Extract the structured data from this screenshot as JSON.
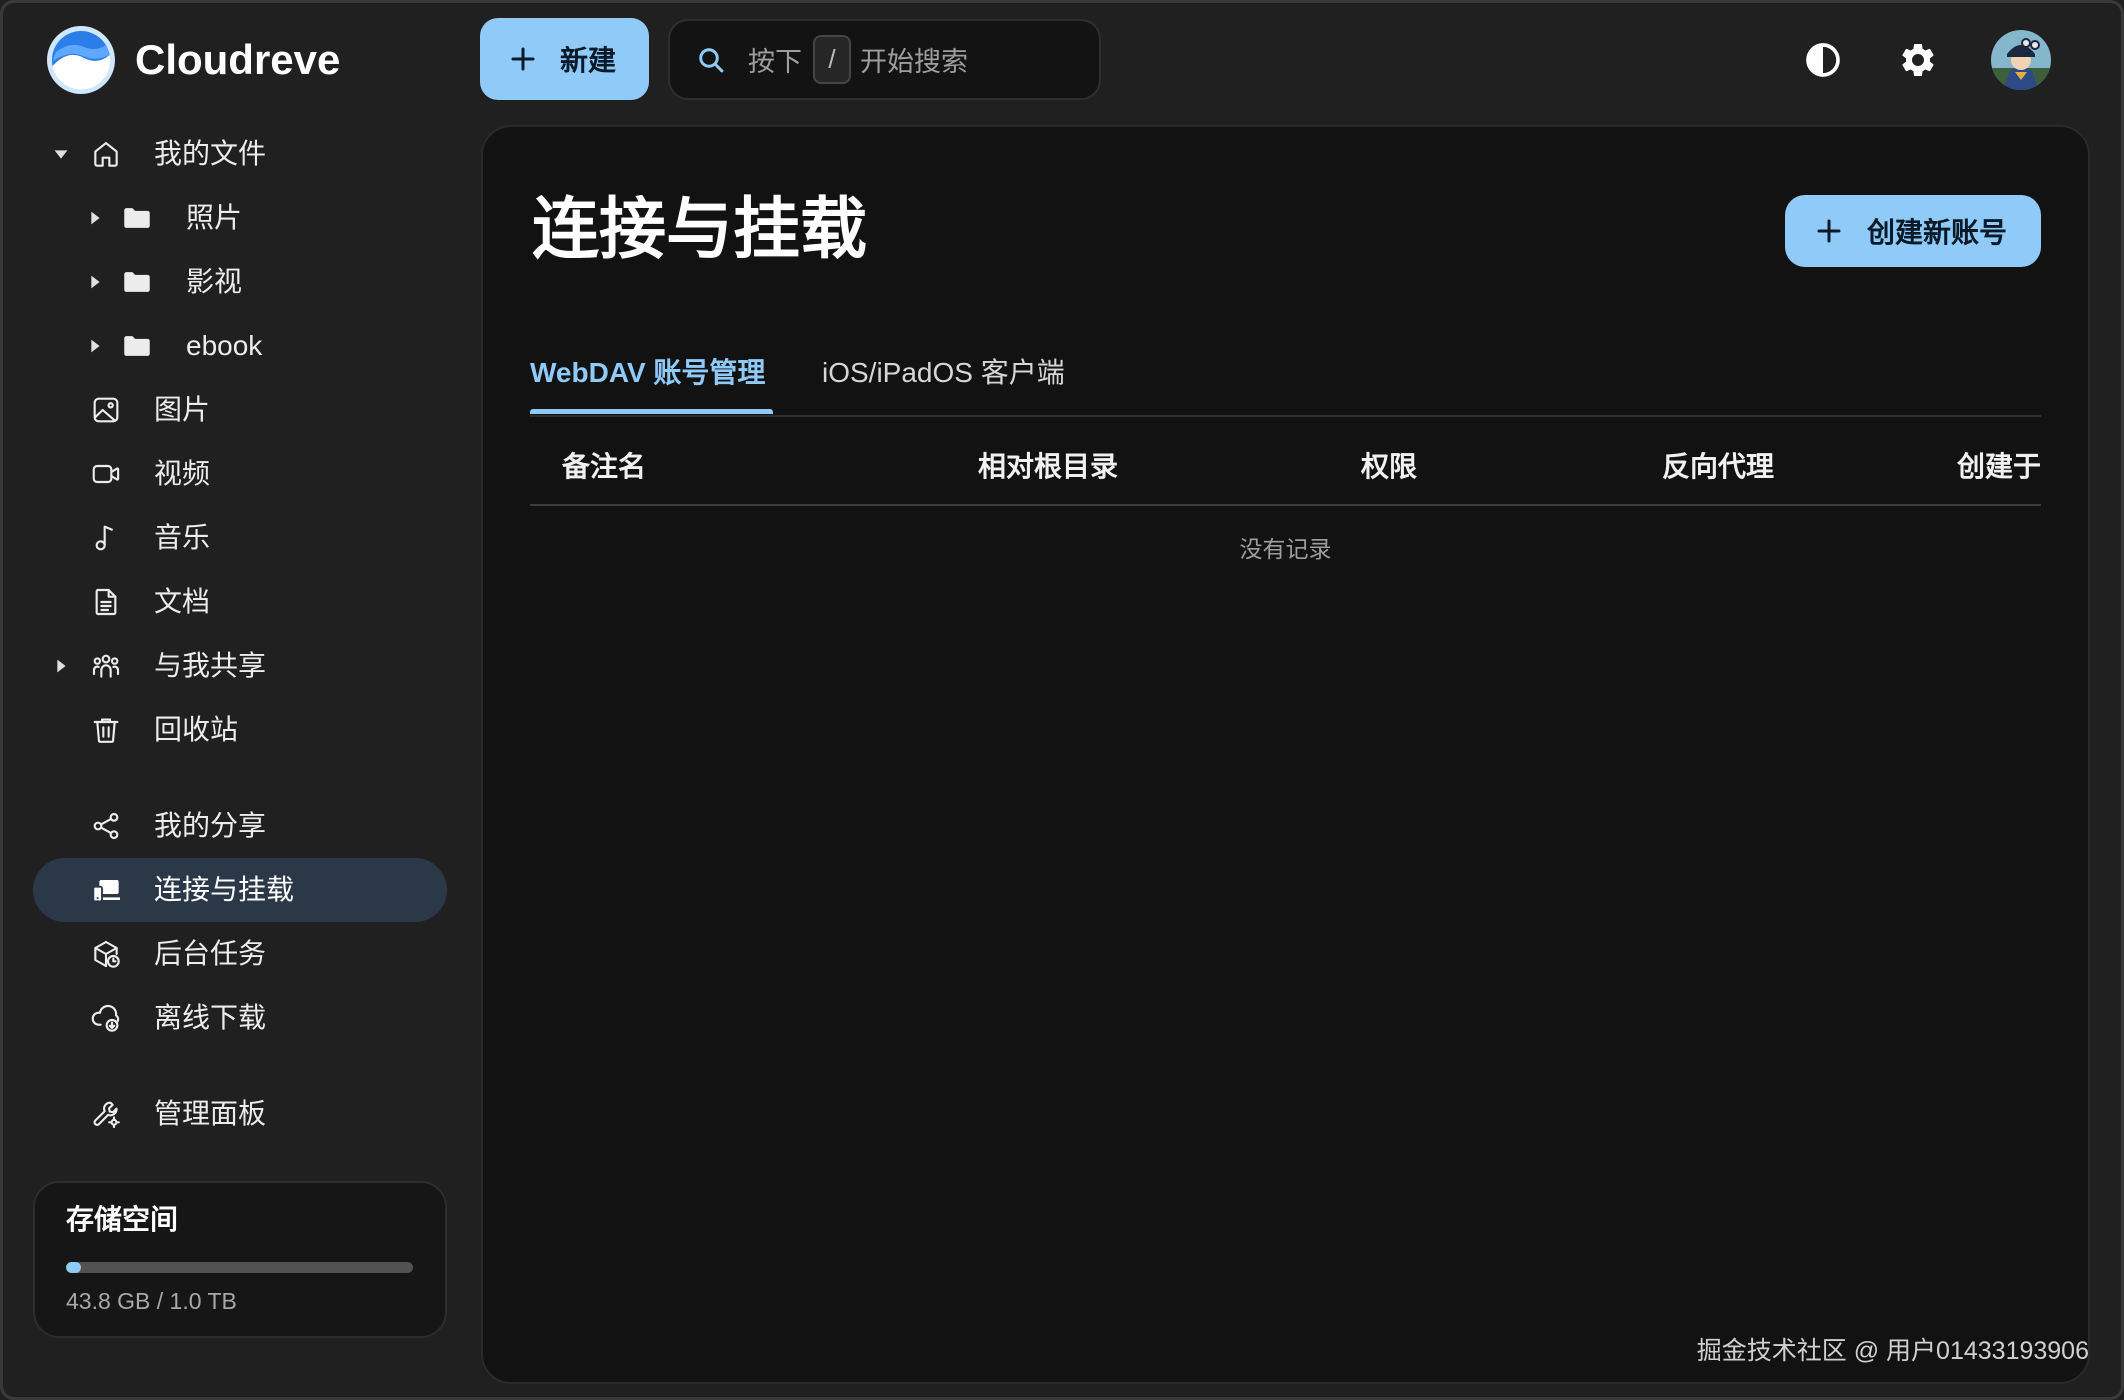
{
  "app": {
    "name": "Cloudreve",
    "logo_icon": "cloudreve-logo-icon"
  },
  "header": {
    "new_button": {
      "label": "新建",
      "icon": "plus-icon"
    },
    "search": {
      "icon": "search-icon",
      "prefix": "按下",
      "shortcut_key": "/",
      "suffix": "开始搜索"
    },
    "theme_toggle": {
      "icon": "contrast-icon"
    },
    "settings": {
      "icon": "gear-icon"
    },
    "user": {
      "icon": "avatar"
    }
  },
  "sidebar": {
    "my_files": {
      "label": "我的文件",
      "icon": "home-icon",
      "expanded": true,
      "children": [
        {
          "label": "照片",
          "icon": "folder-icon",
          "expanded": false
        },
        {
          "label": "影视",
          "icon": "folder-icon",
          "expanded": false
        },
        {
          "label": "ebook",
          "icon": "folder-icon",
          "expanded": false
        }
      ]
    },
    "categories": [
      {
        "label": "图片",
        "icon": "image-icon"
      },
      {
        "label": "视频",
        "icon": "video-icon"
      },
      {
        "label": "音乐",
        "icon": "music-icon"
      },
      {
        "label": "文档",
        "icon": "document-icon"
      }
    ],
    "shared_with_me": {
      "label": "与我共享",
      "icon": "people-icon",
      "expanded": false
    },
    "trash": {
      "label": "回收站",
      "icon": "trash-icon"
    },
    "tools": [
      {
        "label": "我的分享",
        "icon": "share-icon",
        "selected": false
      },
      {
        "label": "连接与挂载",
        "icon": "devices-icon",
        "selected": true
      },
      {
        "label": "后台任务",
        "icon": "tasks-icon",
        "selected": false
      },
      {
        "label": "离线下载",
        "icon": "cloud-download-icon",
        "selected": false
      }
    ],
    "admin": {
      "label": "管理面板",
      "icon": "admin-icon"
    },
    "storage": {
      "title": "存储空间",
      "usage_text": "43.8 GB / 1.0 TB",
      "used_fraction": 0.043
    }
  },
  "main": {
    "title": "连接与挂载",
    "create_button": {
      "label": "创建新账号",
      "icon": "plus-icon"
    },
    "tabs": [
      {
        "label": "WebDAV 账号管理",
        "active": true
      },
      {
        "label": "iOS/iPadOS 客户端",
        "active": false
      }
    ],
    "table": {
      "columns": [
        "备注名",
        "相对根目录",
        "权限",
        "反向代理",
        "创建于"
      ],
      "rows": [],
      "empty_text": "没有记录"
    }
  },
  "watermark": "掘金技术社区 @ 用户01433193906",
  "colors": {
    "background": "#202020",
    "panel": "#121212",
    "accent": "#90caf9",
    "selected_row": "#2a3848",
    "muted_text": "#9e9e9e"
  }
}
